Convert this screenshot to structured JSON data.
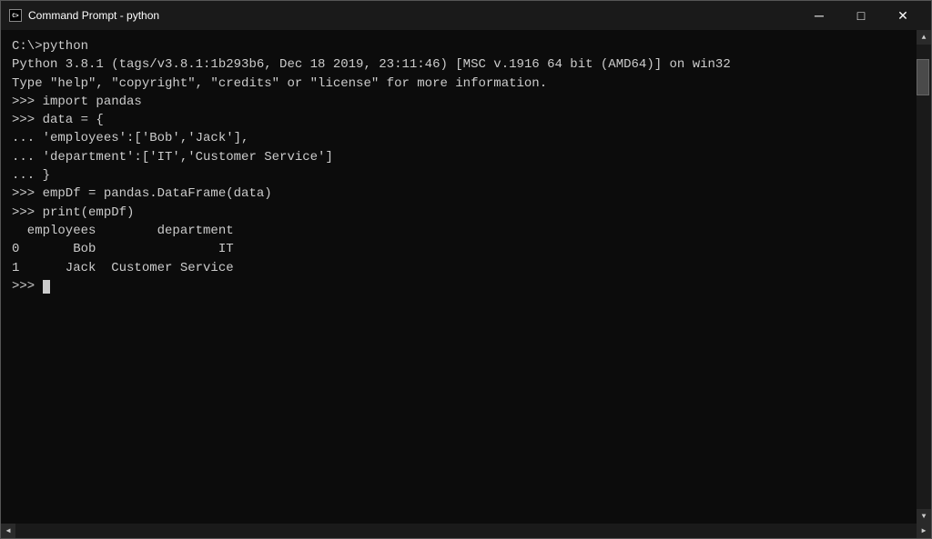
{
  "window": {
    "title": "Command Prompt - python",
    "icon": "cmd-icon"
  },
  "titlebar": {
    "minimize_label": "─",
    "maximize_label": "□",
    "close_label": "✕"
  },
  "console": {
    "lines": [
      "C:\\>python",
      "Python 3.8.1 (tags/v3.8.1:1b293b6, Dec 18 2019, 23:11:46) [MSC v.1916 64 bit (AMD64)] on win32",
      "Type \"help\", \"copyright\", \"credits\" or \"license\" for more information.",
      ">>> import pandas",
      ">>> data = {",
      "... 'employees':['Bob','Jack'],",
      "... 'department':['IT','Customer Service']",
      "... }",
      ">>> empDf = pandas.DataFrame(data)",
      ">>> print(empDf)",
      "  employees        department",
      "0       Bob                IT",
      "1      Jack  Customer Service",
      ">>> "
    ]
  }
}
